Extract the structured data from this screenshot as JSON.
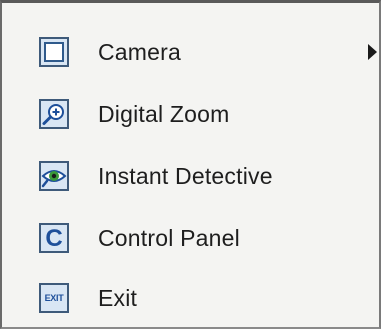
{
  "menu": {
    "items": [
      {
        "label": "Camera",
        "icon": "camera-square-icon",
        "has_submenu": true
      },
      {
        "label": "Digital Zoom",
        "icon": "zoom-icon",
        "has_submenu": false
      },
      {
        "label": "Instant Detective",
        "icon": "eye-icon",
        "has_submenu": false
      },
      {
        "label": "Control Panel",
        "icon": "control-panel-icon",
        "icon_text": "C",
        "has_submenu": false
      },
      {
        "label": "Exit",
        "icon": "exit-icon",
        "icon_text": "EXIT",
        "has_submenu": false
      }
    ]
  },
  "colors": {
    "background": "#f4f4f2",
    "icon_border": "#3e5a7a",
    "icon_fill": "#d9e6f4",
    "icon_accent": "#1d4f9a",
    "text": "#1e1e1e"
  }
}
